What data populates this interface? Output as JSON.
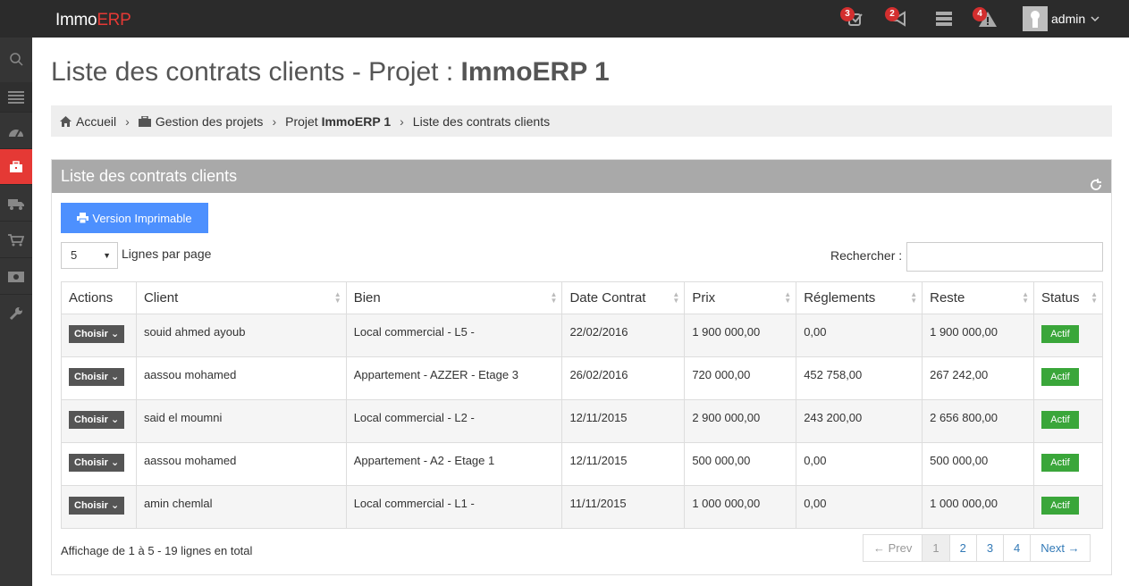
{
  "app": {
    "logo_main": "Immo",
    "logo_accent": "ERP",
    "user_name": "admin"
  },
  "topbar": {
    "badges": [
      "3",
      "2",
      "",
      "4"
    ]
  },
  "page": {
    "title_prefix": "Liste des contrats clients - Projet : ",
    "title_project": "ImmoERP 1"
  },
  "breadcrumb": {
    "home": "Accueil",
    "projects": "Gestion des projets",
    "project_prefix": "Projet ",
    "project_name": "ImmoERP 1",
    "current": "Liste des contrats clients"
  },
  "portlet": {
    "title": "Liste des contrats clients",
    "print_label": "Version Imprimable"
  },
  "controls": {
    "page_length": "5",
    "page_length_label": "Lignes par page",
    "search_label": "Rechercher :",
    "search_value": ""
  },
  "table": {
    "headers": [
      "Actions",
      "Client",
      "Bien",
      "Date Contrat",
      "Prix",
      "Réglements",
      "Reste",
      "Status"
    ],
    "action_label": "Choisir",
    "rows": [
      {
        "client": "souid ahmed ayoub",
        "bien": "Local commercial - L5 -",
        "date": "22/02/2016",
        "prix": "1 900 000,00",
        "reglements": "0,00",
        "reste": "1 900 000,00",
        "status": "Actif"
      },
      {
        "client": "aassou mohamed",
        "bien": "Appartement - AZZER - Etage 3",
        "date": "26/02/2016",
        "prix": "720 000,00",
        "reglements": "452 758,00",
        "reste": "267 242,00",
        "status": "Actif"
      },
      {
        "client": "said el moumni",
        "bien": "Local commercial - L2 -",
        "date": "12/11/2015",
        "prix": "2 900 000,00",
        "reglements": "243 200,00",
        "reste": "2 656 800,00",
        "status": "Actif"
      },
      {
        "client": "aassou mohamed",
        "bien": "Appartement - A2 - Etage 1",
        "date": "12/11/2015",
        "prix": "500 000,00",
        "reglements": "0,00",
        "reste": "500 000,00",
        "status": "Actif"
      },
      {
        "client": "amin chemlal",
        "bien": "Local commercial - L1 -",
        "date": "11/11/2015",
        "prix": "1 000 000,00",
        "reglements": "0,00",
        "reste": "1 000 000,00",
        "status": "Actif"
      }
    ]
  },
  "footer": {
    "info": "Affichage de 1 à 5 - 19 lignes en total"
  },
  "pagination": {
    "prev": "← Prev",
    "pages": [
      "1",
      "2",
      "3",
      "4"
    ],
    "current_page": "1",
    "next": "Next →"
  },
  "colors": {
    "accent": "#e53935",
    "primary": "#4d90fe",
    "success": "#3aa63a",
    "topbar": "#2b2b2b",
    "sidebar": "#353535"
  }
}
